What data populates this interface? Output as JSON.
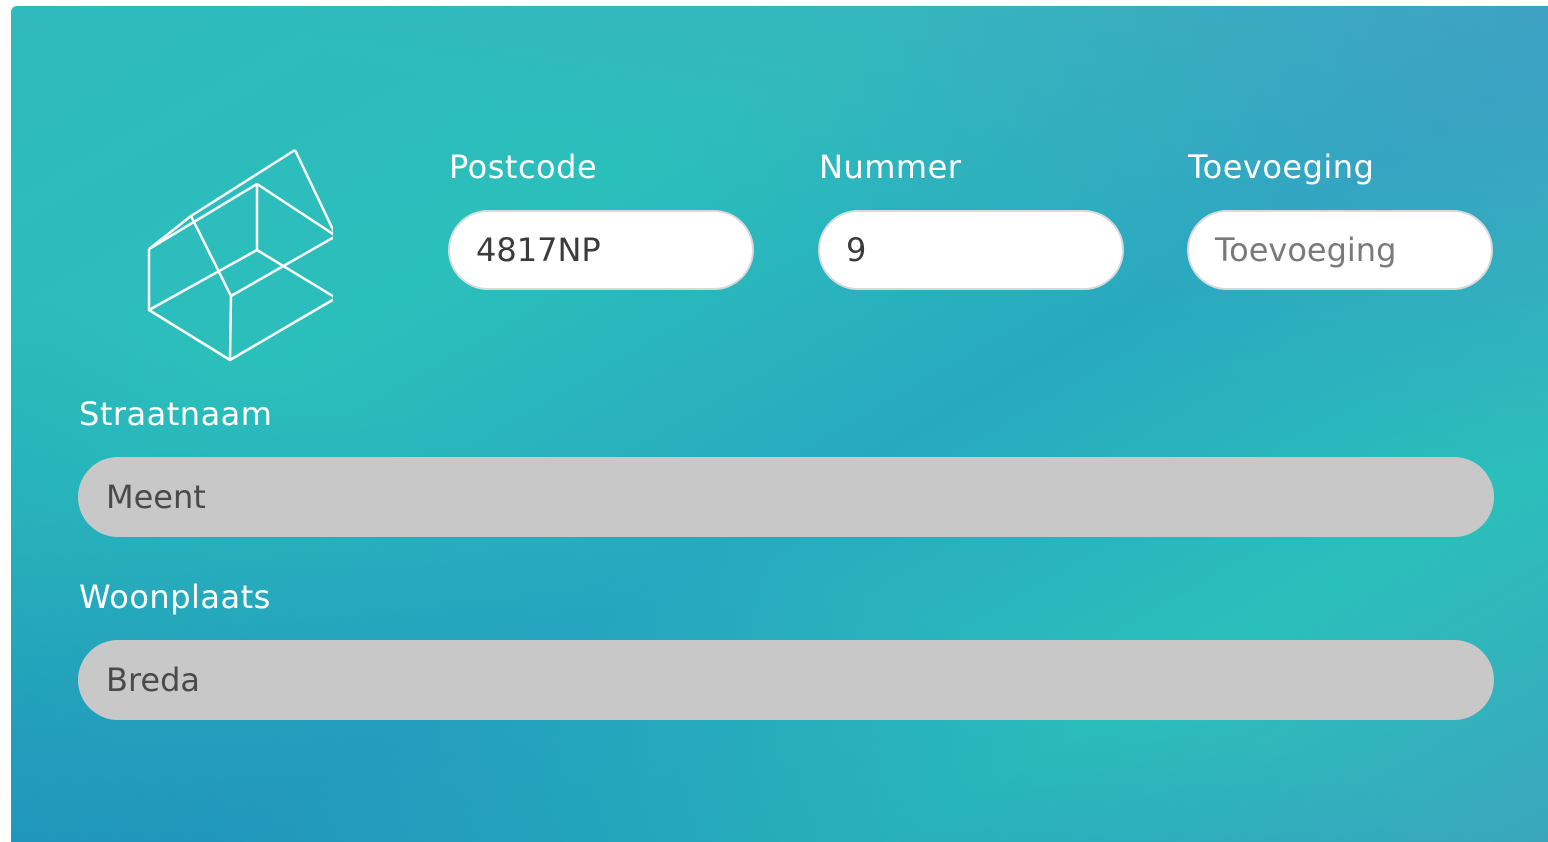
{
  "form": {
    "postcode": {
      "label": "Postcode",
      "value": "4817NP"
    },
    "nummer": {
      "label": "Nummer",
      "value": "9"
    },
    "toevoeging": {
      "label": "Toevoeging",
      "placeholder": "Toevoeging",
      "value": ""
    },
    "straatnaam": {
      "label": "Straatnaam",
      "value": "Meent"
    },
    "woonplaats": {
      "label": "Woonplaats",
      "value": "Breda"
    }
  },
  "icons": {
    "house": "house-outline-icon"
  },
  "colors": {
    "background_gradient": [
      "#2fb9bd",
      "#2bbfbb",
      "#28a9c0"
    ],
    "field_bg": "#ffffff",
    "field_disabled_bg": "#c8c8c8",
    "label_text": "#ffffff"
  }
}
